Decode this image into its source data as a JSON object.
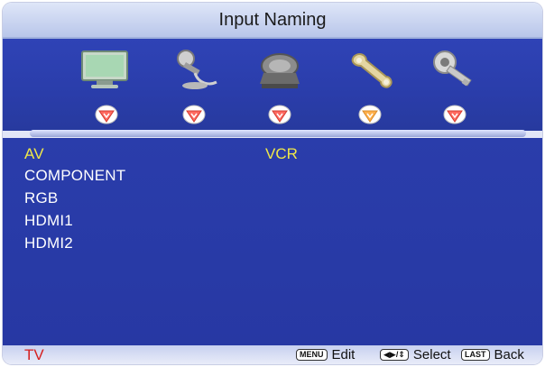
{
  "window": {
    "title": "Input Naming"
  },
  "menu": {
    "icons": [
      {
        "name": "picture-icon"
      },
      {
        "name": "audio-icon"
      },
      {
        "name": "tv-icon"
      },
      {
        "name": "setup-icon"
      },
      {
        "name": "lock-icon"
      }
    ],
    "selected_index": 3,
    "badge_colors": {
      "normal": "#ff6a60",
      "selected": "#ffb04a"
    }
  },
  "list": {
    "items": [
      {
        "label": "AV",
        "selected": true
      },
      {
        "label": "COMPONENT",
        "selected": false
      },
      {
        "label": "RGB",
        "selected": false
      },
      {
        "label": "HDMI1",
        "selected": false
      },
      {
        "label": "HDMI2",
        "selected": false
      }
    ],
    "current_value": "VCR"
  },
  "footer": {
    "source": "TV",
    "menu_key": "MENU",
    "menu_action": "Edit",
    "select_key": "◀▶/⇕",
    "select_action": "Select",
    "last_key": "LAST",
    "last_action": "Back"
  },
  "colors": {
    "selected_text": "#f0e848",
    "normal_text": "#ffffff",
    "source_text": "#d52020"
  }
}
